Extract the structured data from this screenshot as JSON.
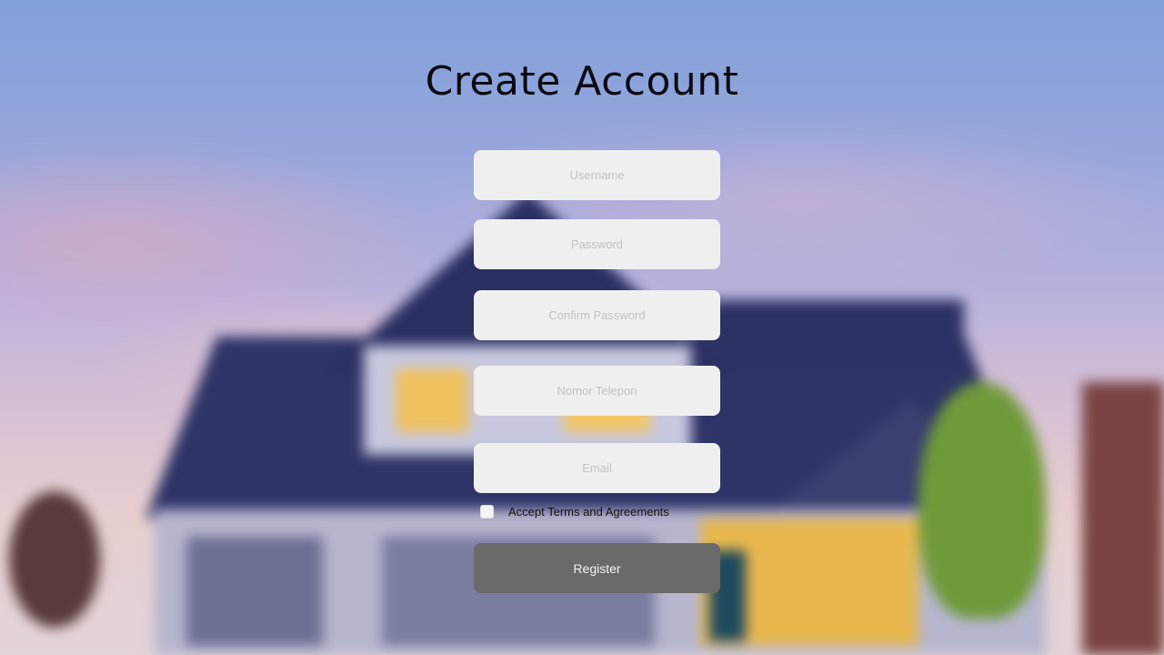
{
  "page": {
    "title": "Create Account"
  },
  "form": {
    "username": {
      "placeholder": "Username",
      "value": ""
    },
    "password": {
      "placeholder": "Password",
      "value": ""
    },
    "confirm_password": {
      "placeholder": "Confirm Password",
      "value": ""
    },
    "phone": {
      "placeholder": "Nomor Telepon",
      "value": ""
    },
    "email": {
      "placeholder": "Email",
      "value": ""
    },
    "terms_label": "Accept Terms and Agreements",
    "terms_checked": false,
    "register_label": "Register"
  },
  "colors": {
    "field_bg": "#efefef",
    "button_bg": "#6a6a6a",
    "title": "#0b0b12"
  }
}
